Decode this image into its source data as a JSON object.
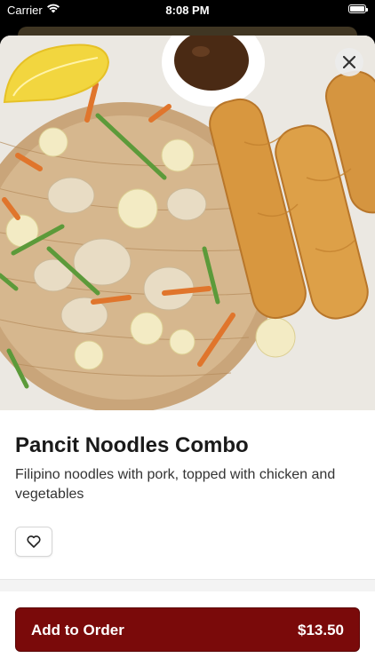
{
  "status_bar": {
    "carrier": "Carrier",
    "time": "8:08 PM",
    "icons": [
      "wifi-icon",
      "battery-icon"
    ]
  },
  "item": {
    "image_alt": "Pancit Noodles Combo",
    "title": "Pancit Noodles Combo",
    "description": "Filipino noodles with pork, topped with chicken and vegetables"
  },
  "actions": {
    "close_icon": "close-icon",
    "favorite_icon": "heart-icon",
    "add_to_order_label": "Add to Order",
    "price": "$13.50"
  },
  "colors": {
    "accent": "#7a0a0a",
    "text_primary": "#1a1a1a",
    "text_secondary": "#333333"
  }
}
